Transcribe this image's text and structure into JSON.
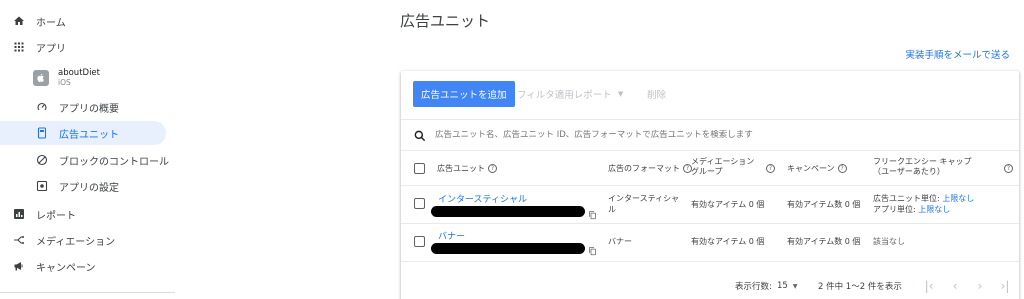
{
  "sidebar": {
    "home": "ホーム",
    "apps": "アプリ",
    "app": {
      "name": "aboutDiet",
      "os": "iOS"
    },
    "sub_items": [
      "アプリの概要",
      "広告ユニット",
      "ブロックのコントロール",
      "アプリの設定"
    ],
    "reports": "レポート",
    "mediation": "メディエーション",
    "campaigns": "キャンペーン"
  },
  "header": {
    "title": "広告ユニット",
    "email_link": "実装手順をメールで送る"
  },
  "toolbar": {
    "add_button": "広告ユニットを追加",
    "filter_button": "フィルタ適用レポート",
    "delete_button": "削除"
  },
  "search": {
    "placeholder": "広告ユニット名、広告ユニット ID、広告フォーマットで広告ユニットを検索します"
  },
  "table": {
    "headers": {
      "ad_unit": "広告ユニット",
      "format": "広告のフォーマット",
      "mediation_line1": "メディエーション",
      "mediation_line2": "グループ",
      "campaign": "キャンペーン",
      "freq_line1": "フリークエンシー キャップ",
      "freq_line2": "（ユーザーあたり）"
    },
    "rows": [
      {
        "name": "インタースティシャル",
        "format_line1": "インタースティシャ",
        "format_line2": "ル",
        "mediation": "有効なアイテム 0 個",
        "campaign": "有効アイテム数 0 個",
        "freq_line1_label": "広告ユニット単位: ",
        "freq_line1_value": "上限なし",
        "freq_line2_label": "アプリ単位: ",
        "freq_line2_value": "上限なし"
      },
      {
        "name": "バナー",
        "format_line1": "バナー",
        "mediation": "有効なアイテム 0 個",
        "campaign": "有効アイテム数 0 個",
        "freq_na": "該当なし"
      }
    ]
  },
  "pagination": {
    "rows_label": "表示行数:",
    "rows_value": "15",
    "range": "2 件中 1～2 件を表示"
  },
  "colors": {
    "accent": "#1a73e8",
    "button": "#4285f4",
    "active_bg": "#e8f0fe"
  }
}
